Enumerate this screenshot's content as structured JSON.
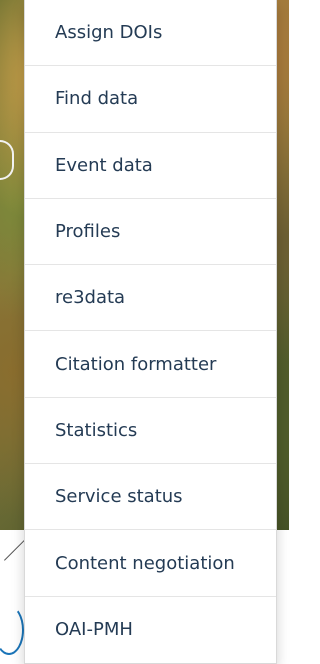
{
  "menu": {
    "items": [
      {
        "label": "Assign DOIs"
      },
      {
        "label": "Find data"
      },
      {
        "label": "Event data"
      },
      {
        "label": "Profiles"
      },
      {
        "label": "re3data"
      },
      {
        "label": "Citation formatter"
      },
      {
        "label": "Statistics"
      },
      {
        "label": "Service status"
      },
      {
        "label": "Content negotiation"
      },
      {
        "label": "OAI-PMH"
      }
    ]
  },
  "colors": {
    "menu_text": "#243b54",
    "menu_background": "#ffffff",
    "divider": "#e5e5e5",
    "accent_arc": "#1a74b8"
  }
}
